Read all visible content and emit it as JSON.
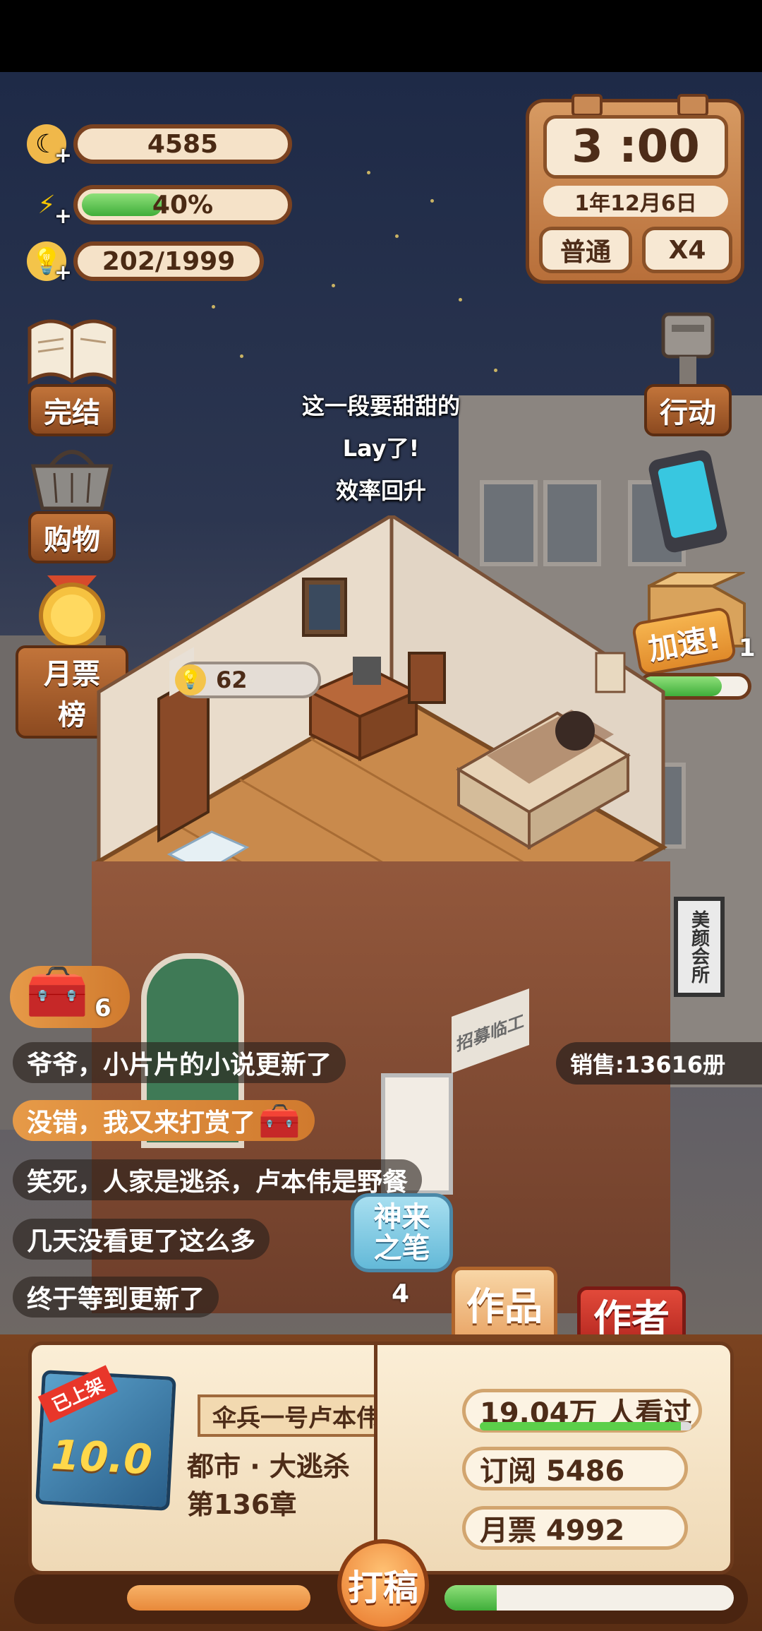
{
  "resources": {
    "coins": "4585",
    "energy_text": "40%",
    "energy_fraction": 0.4,
    "inspiration": "202/1999"
  },
  "clock": {
    "time": "3 :00",
    "date": "1年12月6日",
    "mode": "普通",
    "speed": "X4"
  },
  "left_menu": {
    "finish": "完结",
    "shop": "购物",
    "ranking": "月票榜"
  },
  "right_menu": {
    "action": "行动",
    "boost": "加速!",
    "boost_count": "1",
    "boost_fraction": 0.75
  },
  "float_text": [
    "这一段要甜甜的",
    "Lay了!",
    "效率回升"
  ],
  "room": {
    "inspiration_bubble": "62",
    "shop_sign": "美颜会所",
    "wall_sign": "招募临工"
  },
  "treasure": {
    "count": "6"
  },
  "chat": [
    "爷爷，小片片的小说更新了",
    "没错，我又来打赏了",
    "笑死，人家是逃杀，卢本伟是野餐",
    "几天没看更了这么多",
    "终于等到更新了"
  ],
  "sales": "销售:13616册",
  "divine_pen": {
    "label": "神来之笔",
    "count": "4"
  },
  "tabs": {
    "works": "作品",
    "author": "作者"
  },
  "book": {
    "status_badge": "已上架",
    "rating": "10.0",
    "title": "伞兵一号卢本伟",
    "genre": "都市 · 大逃杀",
    "chapter": "第136章",
    "views": "19.04万 人看过",
    "views_fraction": 0.95,
    "subscriptions": "订阅 5486",
    "monthly_votes": "月票 4992",
    "write_button": "打稿",
    "left_progress": 1.0,
    "right_progress": 0.18
  },
  "colors": {
    "accent_orange": "#e8893a",
    "green_bar": "#5ccf4a",
    "brown_frame": "#6d3a1c"
  }
}
